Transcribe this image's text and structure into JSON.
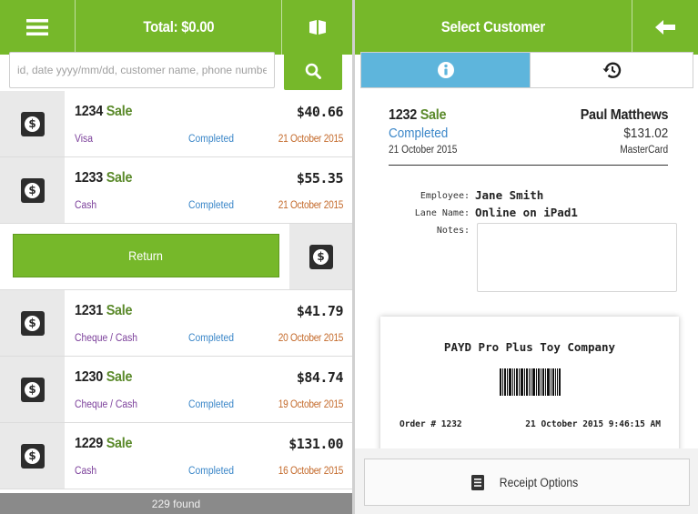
{
  "left_header": {
    "menu_icon": "hamburger-menu-icon",
    "total_label": "Total: $0.00",
    "book_icon": "open-book-icon"
  },
  "search": {
    "placeholder": "id, date yyyy/mm/dd, customer name, phone number, em",
    "value": "",
    "button_icon": "search-icon"
  },
  "sales": [
    {
      "number": "1234",
      "type": "Sale",
      "method": "Visa",
      "status": "Completed",
      "amount": "$40.66",
      "date": "21 October 2015",
      "icon": "money-receipt-icon"
    },
    {
      "number": "1233",
      "type": "Sale",
      "method": "Cash",
      "status": "Completed",
      "amount": "$55.35",
      "date": "21 October 2015",
      "icon": "money-receipt-icon"
    },
    {
      "number": "1231",
      "type": "Sale",
      "method": "Cheque / Cash",
      "status": "Completed",
      "amount": "$41.79",
      "date": "20 October 2015",
      "icon": "money-receipt-icon"
    },
    {
      "number": "1230",
      "type": "Sale",
      "method": "Cheque / Cash",
      "status": "Completed",
      "amount": "$84.74",
      "date": "19 October 2015",
      "icon": "money-receipt-icon"
    },
    {
      "number": "1229",
      "type": "Sale",
      "method": "Cash",
      "status": "Completed",
      "amount": "$131.00",
      "date": "16 October 2015",
      "icon": "money-receipt-icon"
    }
  ],
  "action_row": {
    "return_label": "Return"
  },
  "footer": {
    "found_label": "229 found"
  },
  "right_header": {
    "title": "Select Customer",
    "back_icon": "arrow-left-icon"
  },
  "tabs": {
    "info_icon": "info-icon",
    "history_icon": "history-icon",
    "active": "info"
  },
  "detail": {
    "number": "1232",
    "type": "Sale",
    "status": "Completed",
    "date": "21 October 2015",
    "customer": "Paul Matthews",
    "total": "$131.02",
    "card": "MasterCard",
    "employee_label": "Employee:",
    "employee": "Jane Smith",
    "lane_label": "Lane Name:",
    "lane": "Online on iPad1",
    "notes_label": "Notes:",
    "notes": ""
  },
  "receipt": {
    "company": "PAYD Pro Plus Toy Company",
    "order": "Order # 1232",
    "timestamp": "21 October 2015 9:46:15 AM"
  },
  "receipt_options": {
    "label": "Receipt Options",
    "icon": "document-icon"
  },
  "colors": {
    "brand_green": "#76b82a",
    "tab_blue": "#5eb5dc",
    "sale_green": "#5b8a2b",
    "status_blue": "#3a86c8",
    "method_purple": "#7b3f9a",
    "date_orange": "#c46a2b"
  }
}
